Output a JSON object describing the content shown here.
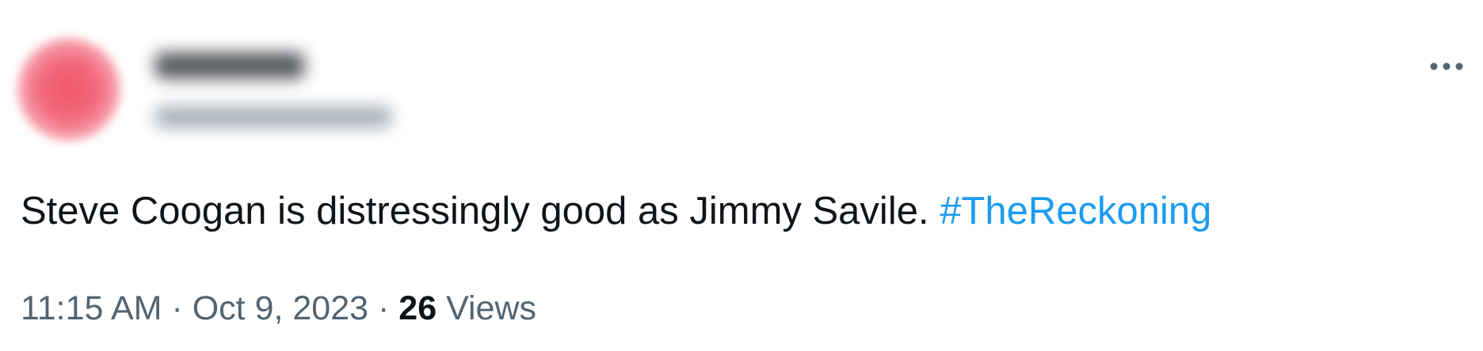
{
  "tweet": {
    "text": "Steve Coogan is distressingly good as Jimmy Savile.",
    "hashtag": "#TheReckoning",
    "time": "11:15 AM",
    "separator": "·",
    "date": "Oct 9, 2023",
    "views_count": "26",
    "views_label": "Views"
  },
  "icons": {
    "more": "more-horizontal-icon"
  },
  "colors": {
    "text": "#0f1419",
    "secondary": "#536471",
    "link": "#1d9bf0"
  }
}
